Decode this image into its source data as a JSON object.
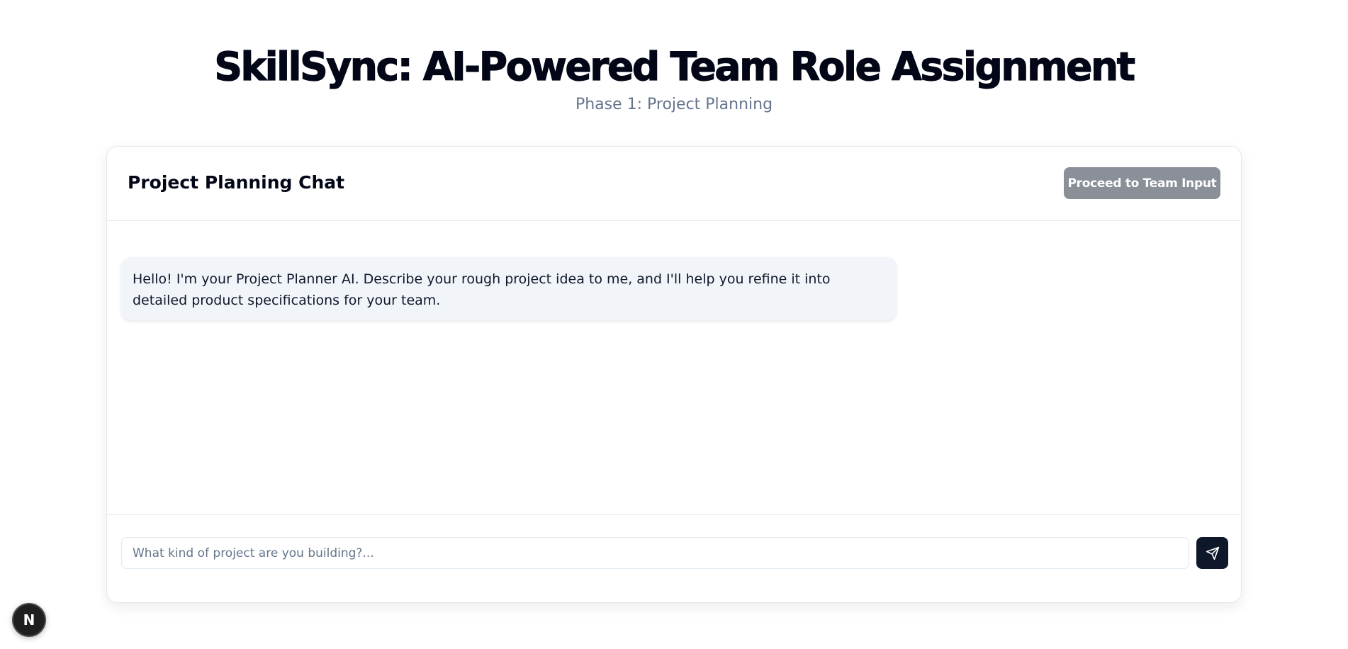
{
  "header": {
    "title": "SkillSync: AI-Powered Team Role Assignment",
    "subtitle": "Phase 1: Project Planning"
  },
  "chat_card": {
    "title": "Project Planning Chat",
    "proceed_label": "Proceed to Team Input",
    "messages": [
      {
        "sender": "assistant",
        "text": "Hello! I'm your Project Planner AI. Describe your rough project idea to me, and I'll help you refine it into detailed product specifications for your team."
      }
    ],
    "input": {
      "placeholder": "What kind of project are you building?...",
      "value": ""
    },
    "send_icon": "send-icon"
  },
  "dev_badge": {
    "letter": "N",
    "icon": "nextjs-icon"
  },
  "colors": {
    "title": "#020617",
    "subtitle": "#64748b",
    "proceed_button_bg": "#8b8f98",
    "bubble_bg": "#f1f5f9",
    "send_button_bg": "#0f172a"
  }
}
